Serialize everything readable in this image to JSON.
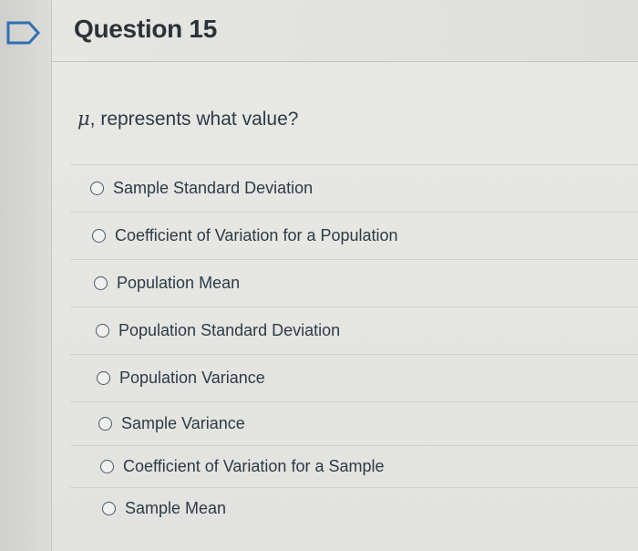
{
  "question": {
    "title": "Question 15",
    "symbol": "μ",
    "prompt": ", represents what value?"
  },
  "answers": [
    {
      "label": "Sample Standard Deviation",
      "selected": false
    },
    {
      "label": "Coefficient of Variation for a Population",
      "selected": false
    },
    {
      "label": "Population Mean",
      "selected": false
    },
    {
      "label": "Population Standard Deviation",
      "selected": false
    },
    {
      "label": "Population Variance",
      "selected": false
    },
    {
      "label": "Sample Variance",
      "selected": false
    },
    {
      "label": "Coefficient of Variation for a Sample",
      "selected": false
    },
    {
      "label": "Sample Mean",
      "selected": false
    }
  ],
  "colors": {
    "flag": "#2f6fb5",
    "text": "#2d3b45",
    "background": "#e4e4e1"
  },
  "icons": {
    "flag": "flag-icon"
  }
}
